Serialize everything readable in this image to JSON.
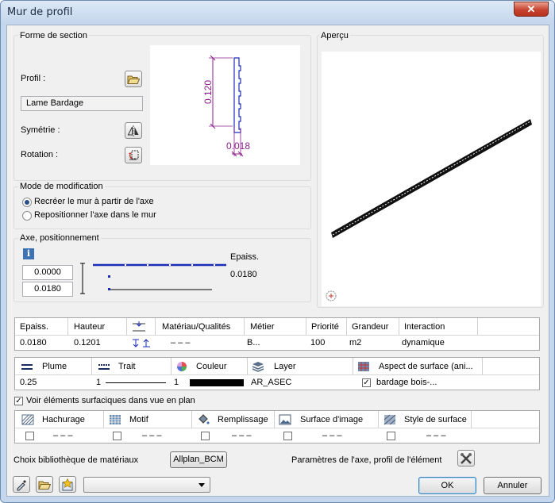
{
  "window": {
    "title": "Mur de profil",
    "close_glyph": "✕"
  },
  "section": {
    "title": "Forme de section",
    "profile_label": "Profil :",
    "profile_value": "Lame Bardage",
    "symmetry_label": "Symétrie :",
    "rotation_label": "Rotation :",
    "drawing": {
      "height_dim": "0.120",
      "width_dim": "0.018"
    }
  },
  "preview": {
    "title": "Aperçu"
  },
  "mode": {
    "title": "Mode de modification",
    "options": [
      "Recréer le mur à partir de l'axe",
      "Repositionner l'axe dans le mur"
    ],
    "selected": 0
  },
  "axis": {
    "title": "Axe, positionnement",
    "info_glyph": "i",
    "value1": "0.0000",
    "value2": "0.0180",
    "thickness_label": "Epaiss.",
    "thickness_value": "0.0180"
  },
  "layers_table": {
    "headers": [
      "Epaiss.",
      "Hauteur",
      "",
      "Matériau/Qualités",
      "Métier",
      "Priorité",
      "Grandeur",
      "Interaction"
    ],
    "row": [
      "0.0180",
      "0.1201",
      "",
      "– – –",
      "B...",
      "100",
      "m2",
      "dynamique"
    ]
  },
  "format_table": {
    "headers": [
      "Plume",
      "Trait",
      "Couleur",
      "Layer",
      "Aspect de surface (ani..."
    ],
    "pen": "0.25",
    "line": "1",
    "color_index": "1",
    "layer": "AR_ASEC",
    "surface": "bardage bois-...",
    "surface_checked": true
  },
  "surface_checkbox": {
    "label": "Voir éléments surfaciques dans vue en plan",
    "checked": true
  },
  "fill_table": {
    "headers": [
      "Hachurage",
      "Motif",
      "Remplissage",
      "Surface d'image",
      "Style de surface"
    ],
    "values": [
      "– – –",
      "– – –",
      "– – –",
      "– – –",
      "– – –"
    ]
  },
  "footer": {
    "material_label": "Choix bibliothèque de matériaux",
    "material_button": "Allplan_BCM",
    "axis_params_label": "Paramètres de l'axe, profil de l'élément",
    "dropdown_value": "",
    "ok": "OK",
    "cancel": "Annuler"
  },
  "colors": {
    "accent": "#1a2cb8",
    "dimension": "#8b1f8b",
    "color_swatch": "#000000"
  }
}
